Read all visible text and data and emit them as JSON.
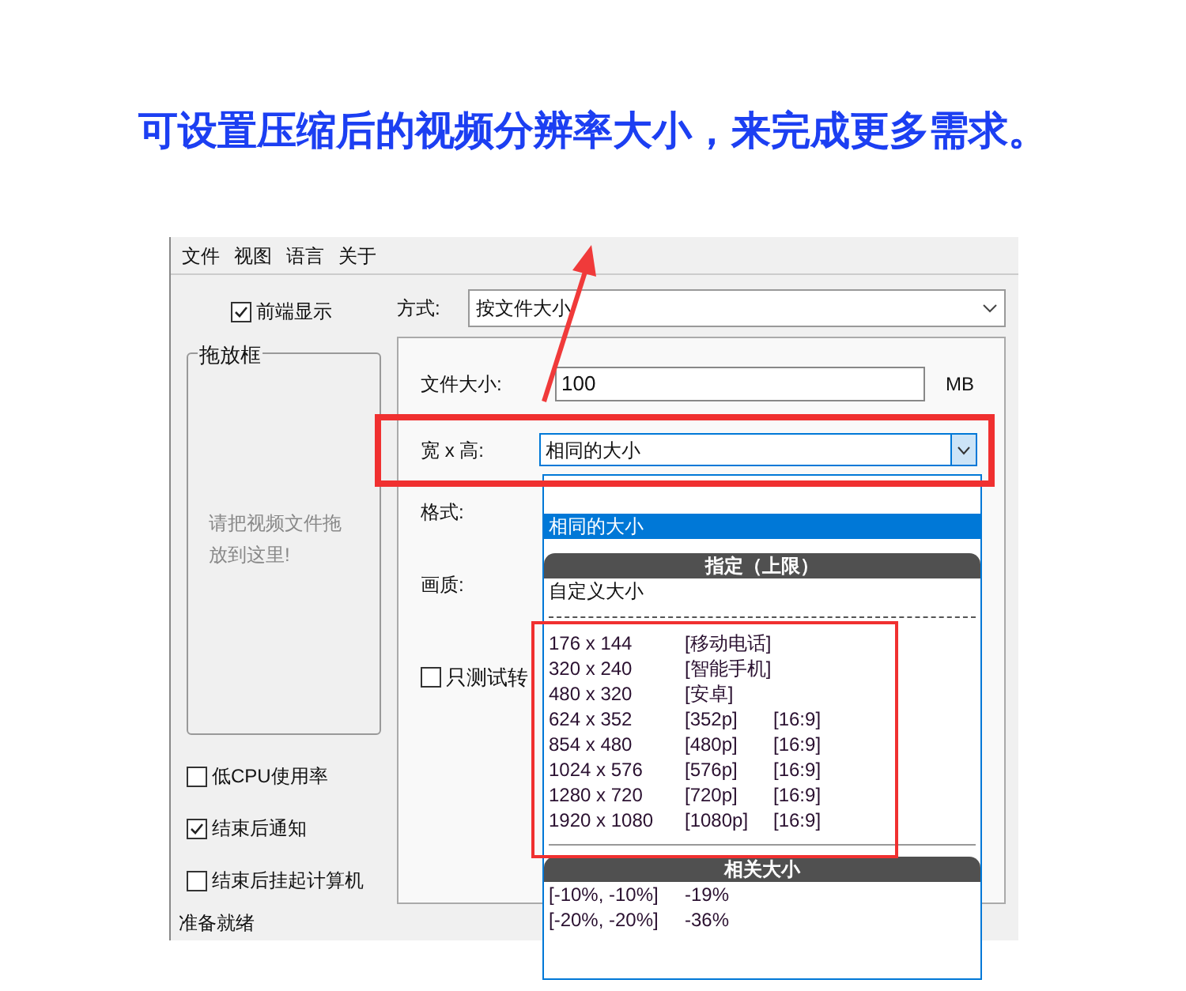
{
  "headline": "可设置压缩后的视频分辨率大小，来完成更多需求。",
  "menu": [
    "文件",
    "视图",
    "语言",
    "关于"
  ],
  "topmost": {
    "label": "前端显示",
    "checked": true
  },
  "drop_box": {
    "title": "拖放框",
    "hint": "请把视频文件拖放到这里!"
  },
  "options": [
    {
      "label": "低CPU使用率",
      "checked": false
    },
    {
      "label": "结束后通知",
      "checked": true
    },
    {
      "label": "结束后挂起计算机",
      "checked": false
    }
  ],
  "status_bar": "准备就绪",
  "mode": {
    "label": "方式:",
    "value": "按文件大小"
  },
  "file_size": {
    "label": "文件大小:",
    "value": "100",
    "unit": "MB"
  },
  "resolution": {
    "label": "宽 x 高:",
    "value": "相同的大小"
  },
  "format": {
    "label": "格式:"
  },
  "quality": {
    "label": "画质:"
  },
  "test_only": {
    "label": "只测试转",
    "checked": false
  },
  "dropdown": [
    {
      "kind": "spacer"
    },
    {
      "kind": "spacer"
    },
    {
      "kind": "spacer"
    },
    {
      "kind": "option",
      "label": "相同的大小",
      "selected": true
    },
    {
      "kind": "spacer"
    },
    {
      "kind": "header",
      "label": "指定（上限）"
    },
    {
      "kind": "option",
      "label": "自定义大小",
      "selected": false
    },
    {
      "kind": "dashes"
    },
    {
      "kind": "size",
      "size": "176 x 144",
      "tag": "[移动电话]"
    },
    {
      "kind": "size",
      "size": "320 x 240",
      "tag": "[智能手机]"
    },
    {
      "kind": "size",
      "size": "480 x 320",
      "tag": "[安卓]"
    },
    {
      "kind": "size",
      "size": "624 x 352",
      "tag": "[352p]",
      "ratio": "[16:9]"
    },
    {
      "kind": "size",
      "size": "854 x 480",
      "tag": "[480p]",
      "ratio": "[16:9]"
    },
    {
      "kind": "size",
      "size": "1024 x 576",
      "tag": "[576p]",
      "ratio": "[16:9]"
    },
    {
      "kind": "size",
      "size": "1280 x 720",
      "tag": "[720p]",
      "ratio": "[16:9]"
    },
    {
      "kind": "size",
      "size": "1920 x 1080",
      "tag": "[1080p]",
      "ratio": "[16:9]"
    },
    {
      "kind": "rule"
    },
    {
      "kind": "header",
      "label": "相关大小"
    },
    {
      "kind": "size",
      "size": "[-10%, -10%]",
      "tag": "-19%"
    },
    {
      "kind": "size",
      "size": "[-20%, -20%]",
      "tag": "-36%"
    }
  ]
}
